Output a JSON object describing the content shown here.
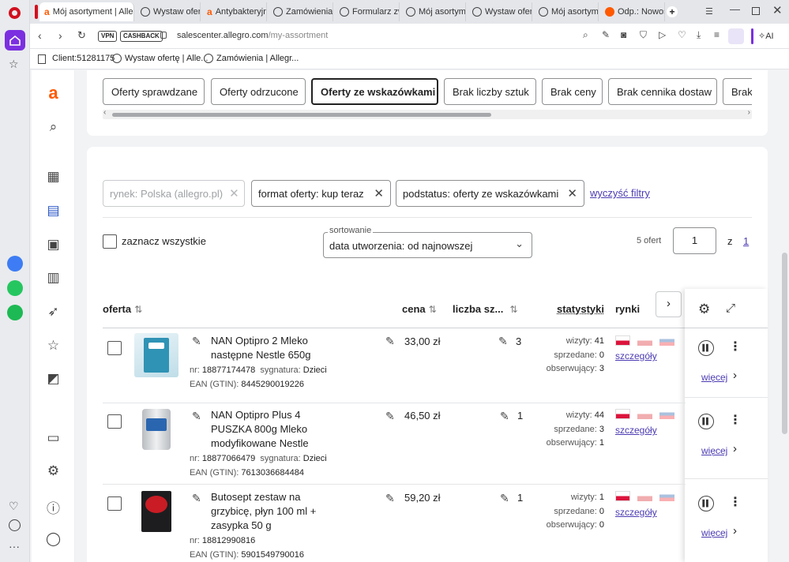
{
  "browser": {
    "tabs": [
      {
        "title": "Mój asortyment | Allegr",
        "icon": "a"
      },
      {
        "title": "Wystaw ofertę",
        "icon": "globe"
      },
      {
        "title": "Antybakteryjny",
        "icon": "a"
      },
      {
        "title": "Zamówienia |",
        "icon": "globe"
      },
      {
        "title": "Formularz zwr",
        "icon": "globe"
      },
      {
        "title": "Mój asortyme",
        "icon": "globe"
      },
      {
        "title": "Wystaw ofertę",
        "icon": "globe"
      },
      {
        "title": "Mój asortyme",
        "icon": "globe"
      },
      {
        "title": "Odp.: Nowość",
        "icon": "ora"
      }
    ],
    "address": {
      "host": "salescenter.allegro.com",
      "path": "/my-assortment"
    },
    "vpn_label": "VPN",
    "cashback_label": "CASHBACK",
    "ai_label": "AI",
    "bookmarks": [
      {
        "label": "Client:51281175"
      },
      {
        "label": "Wystaw ofertę | Alle..."
      },
      {
        "label": "Zamówienia | Allegr..."
      }
    ]
  },
  "status_chips": [
    {
      "label": "Oferty sprawdzane",
      "selected": false
    },
    {
      "label": "Oferty odrzucone",
      "selected": false
    },
    {
      "label": "Oferty ze wskazówkami",
      "selected": true
    },
    {
      "label": "Brak liczby sztuk",
      "selected": false
    },
    {
      "label": "Brak ceny",
      "selected": false
    },
    {
      "label": "Brak cennika dostaw",
      "selected": false
    },
    {
      "label": "Brak",
      "selected": false
    }
  ],
  "filters": {
    "market": {
      "label": "rynek:",
      "value": "Polska (allegro.pl)"
    },
    "format": {
      "label": "format oferty:",
      "value": "kup teraz"
    },
    "substatus": {
      "label": "podstatus:",
      "value": "oferty ze wskazówkami"
    },
    "clear_label": "wyczyść filtry"
  },
  "select_all_label": "zaznacz wszystkie",
  "sorting": {
    "label": "sortowanie",
    "value": "data utworzenia: od najnowszej"
  },
  "pagination": {
    "count_label": "5 ofert",
    "current_page": "1",
    "of_label": "z",
    "total_pages": "1"
  },
  "columns": {
    "offer": "oferta",
    "price": "cena",
    "quantity": "liczba sz...",
    "stats": "statystyki",
    "markets": "rynki"
  },
  "stat_labels": {
    "visits": "wizyty:",
    "sold": "sprzedane:",
    "watching": "obserwujący:"
  },
  "details_label": "szczegóły",
  "more_label": "więcej",
  "offers": [
    {
      "title_lines": [
        "NAN Optipro 2 Mleko",
        "następne Nestle 650g"
      ],
      "nr_label": "nr:",
      "nr": "18877174478",
      "signature_label": "sygnatura:",
      "signature": "Dzieci",
      "ean_label": "EAN (GTIN):",
      "ean": "8445290019226",
      "price": "33,00 zł",
      "quantity": "3",
      "visits": "41",
      "sold": "0",
      "watching": "3"
    },
    {
      "title_lines": [
        "NAN Optipro Plus 4",
        "PUSZKA 800g Mleko",
        "modyfikowane Nestle"
      ],
      "nr_label": "nr:",
      "nr": "18877066479",
      "signature_label": "sygnatura:",
      "signature": "Dzieci",
      "ean_label": "EAN (GTIN):",
      "ean": "7613036684484",
      "price": "46,50 zł",
      "quantity": "1",
      "visits": "44",
      "sold": "3",
      "watching": "1"
    },
    {
      "title_lines": [
        "Butosept zestaw na",
        "grzybicę, płyn 100 ml +",
        "zasypka 50 g"
      ],
      "nr_label": "nr:",
      "nr": "18812990816",
      "signature_label": "",
      "signature": "",
      "ean_label": "EAN (GTIN):",
      "ean": "5901549790016",
      "price": "59,20 zł",
      "quantity": "1",
      "visits": "1",
      "sold": "0",
      "watching": "0"
    }
  ],
  "colors": {
    "accent": "#ff5a00",
    "link": "#4b3bb3",
    "opera": "#d1101e",
    "rail_active": "#7b2fe0"
  }
}
